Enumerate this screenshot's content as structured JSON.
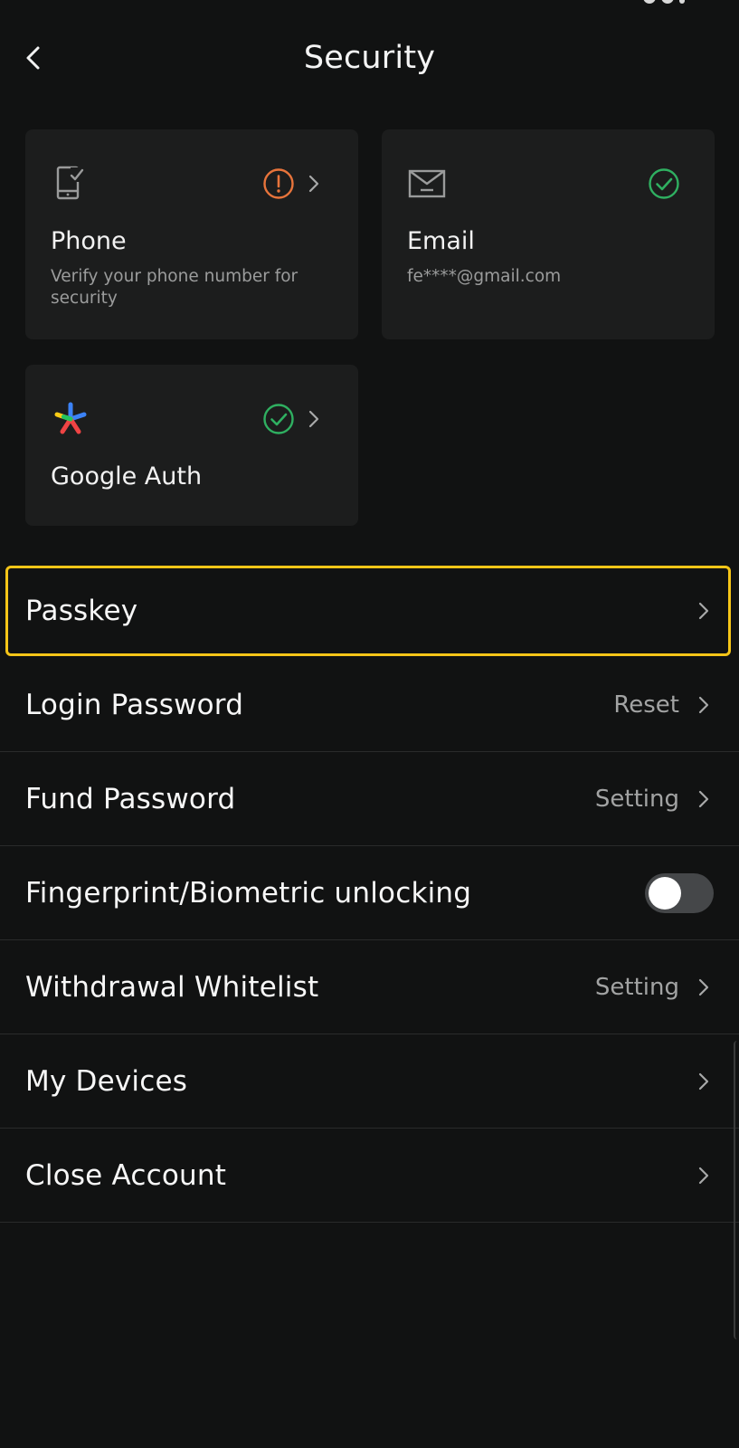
{
  "header": {
    "title": "Security",
    "back_icon": "chevron-left-icon"
  },
  "cards": {
    "phone": {
      "title": "Phone",
      "subtitle": "Verify your phone number for security",
      "icon": "phone-check-icon",
      "status_icon": "warning-circle-icon",
      "status_color": "#e8743b"
    },
    "email": {
      "title": "Email",
      "subtitle": "fe****@gmail.com",
      "icon": "envelope-icon",
      "status_icon": "check-circle-icon",
      "status_color": "#2fb061"
    },
    "google": {
      "title": "Google Auth",
      "icon": "google-authenticator-icon",
      "status_icon": "check-circle-icon",
      "status_color": "#2fb061"
    }
  },
  "list": {
    "passkey": {
      "label": "Passkey"
    },
    "login_password": {
      "label": "Login Password",
      "value": "Reset"
    },
    "fund_password": {
      "label": "Fund Password",
      "value": "Setting"
    },
    "biometric": {
      "label": "Fingerprint/Biometric unlocking",
      "enabled": false
    },
    "withdrawal_whitelist": {
      "label": "Withdrawal Whitelist",
      "value": "Setting"
    },
    "my_devices": {
      "label": "My Devices"
    },
    "close_account": {
      "label": "Close Account"
    }
  },
  "colors": {
    "background": "#111212",
    "card": "#1c1d1d",
    "highlight": "#f5c518",
    "warning": "#e8743b",
    "success": "#2fb061"
  }
}
